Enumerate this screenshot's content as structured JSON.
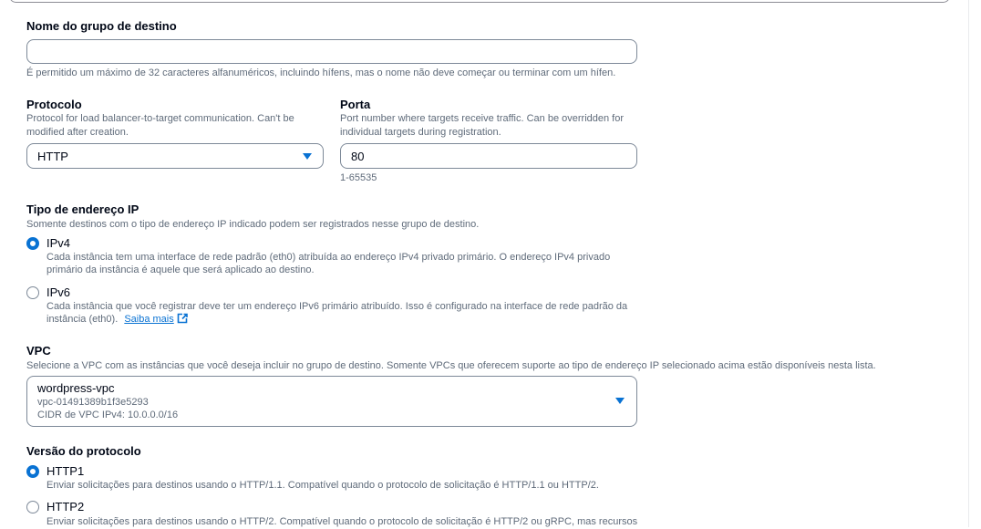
{
  "target_group_name": {
    "label": "Nome do grupo de destino",
    "value": "",
    "constraint": "É permitido um máximo de 32 caracteres alfanuméricos, incluindo hífens, mas o nome não deve começar ou terminar com um hífen."
  },
  "protocol": {
    "label": "Protocolo",
    "description_line1": "Protocol for load balancer-to-target communication. Can't be",
    "description_line2": "modified after creation.",
    "selected": "HTTP"
  },
  "port": {
    "label": "Porta",
    "description_line1": "Port number where targets receive traffic. Can be overridden for",
    "description_line2": "individual targets during registration.",
    "value": "80",
    "range": "1-65535"
  },
  "ip_address_type": {
    "label": "Tipo de endereço IP",
    "description": "Somente destinos com o tipo de endereço IP indicado podem ser registrados nesse grupo de destino.",
    "options": [
      {
        "label": "IPv4",
        "checked": true,
        "desc_line1": "Cada instância tem uma interface de rede padrão (eth0) atribuída ao endereço IPv4 privado primário. O endereço IPv4 privado",
        "desc_line2": "primário da instância é aquele que será aplicado ao destino."
      },
      {
        "label": "IPv6",
        "checked": false,
        "desc_line1": "Cada instância que você registrar deve ter um endereço IPv6 primário atribuído. Isso é configurado na interface de rede padrão da",
        "desc_line2": "instância (eth0).",
        "link": "Saiba mais"
      }
    ]
  },
  "vpc": {
    "label": "VPC",
    "description": "Selecione a VPC com as instâncias que você deseja incluir no grupo de destino. Somente VPCs que oferecem suporte ao tipo de endereço IP selecionado acima estão disponíveis nesta lista.",
    "selected_name": "wordpress-vpc",
    "selected_id": "vpc-01491389b1f3e5293",
    "selected_cidr": "CIDR de VPC IPv4: 10.0.0.0/16"
  },
  "protocol_version": {
    "label": "Versão do protocolo",
    "options": [
      {
        "label": "HTTP1",
        "checked": true,
        "desc": "Enviar solicitações para destinos usando o HTTP/1.1. Compatível quando o protocolo de solicitação é HTTP/1.1 ou HTTP/2."
      },
      {
        "label": "HTTP2",
        "checked": false,
        "desc": "Enviar solicitações para destinos usando o HTTP/2. Compatível quando o protocolo de solicitação é HTTP/2 ou gRPC, mas recursos"
      }
    ]
  },
  "colors": {
    "accent": "#0972d3",
    "text": "#000716",
    "secondary_text": "#5f6b7a",
    "border": "#7d8998"
  }
}
